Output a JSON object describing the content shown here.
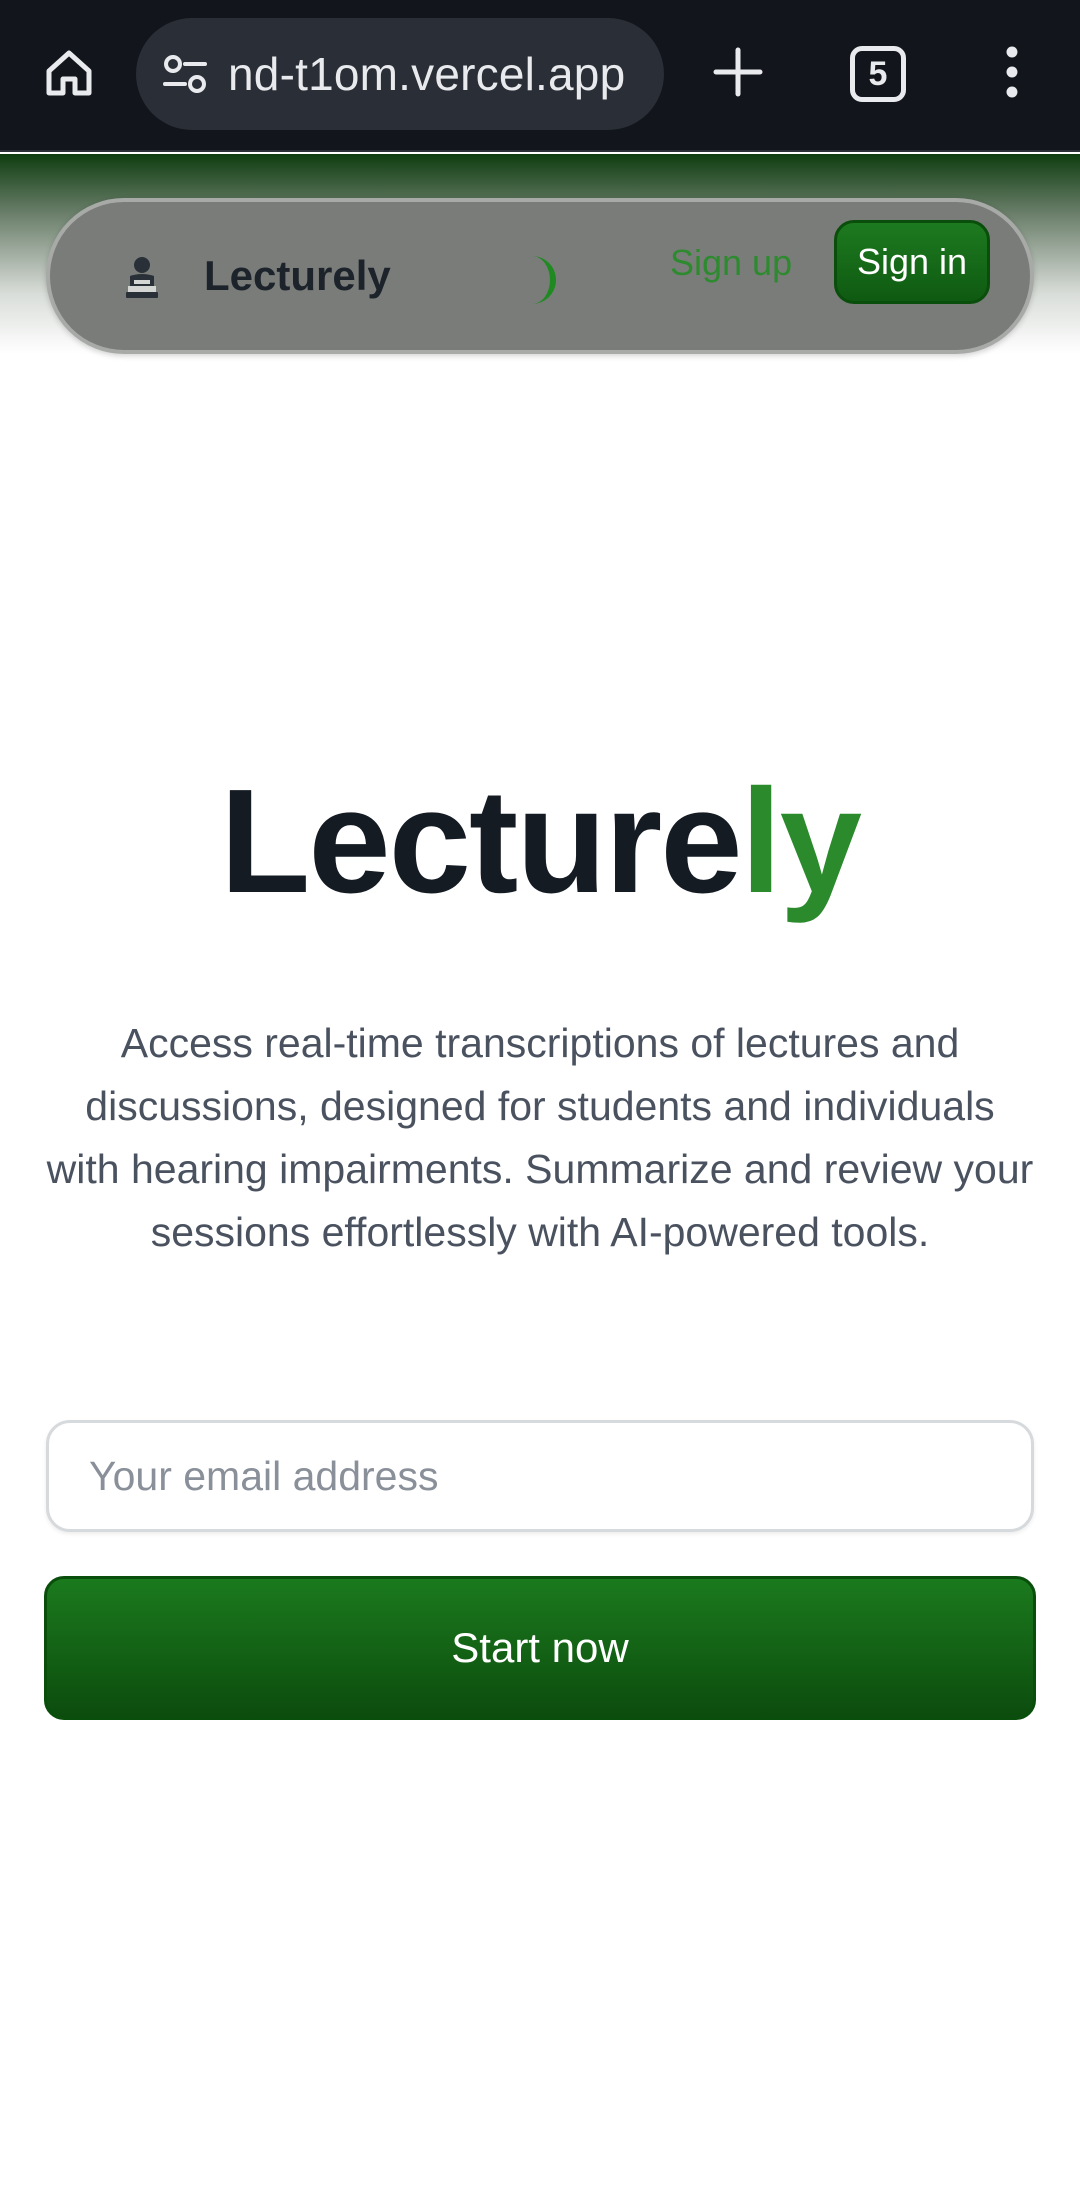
{
  "browser": {
    "url": "nd-t1om.vercel.app",
    "tab_count": "5",
    "icons": {
      "home": "home-icon",
      "site_info": "site-info-icon",
      "new_tab": "plus-icon",
      "tabs": "tab-switcher-icon",
      "menu": "more-vert-icon"
    }
  },
  "navbar": {
    "brand_name": "Lecturely",
    "brand_icon": "student-reading-icon",
    "theme_icon": "moon-icon",
    "signup_label": "Sign up",
    "signin_label": "Sign in"
  },
  "hero": {
    "title_main": "Lecture",
    "title_accent": "ly",
    "description": "Access real-time transcriptions of lectures and discussions, designed for students and individuals with hearing impairments. Summarize and review your sessions effortlessly with AI-powered tools.",
    "email_placeholder": "Your email address",
    "email_value": "",
    "cta_label": "Start now"
  },
  "colors": {
    "accent_green": "#2a8a2c",
    "button_green": "#0f5a12",
    "title_dark": "#151b23",
    "body_gray": "#4a5260"
  }
}
